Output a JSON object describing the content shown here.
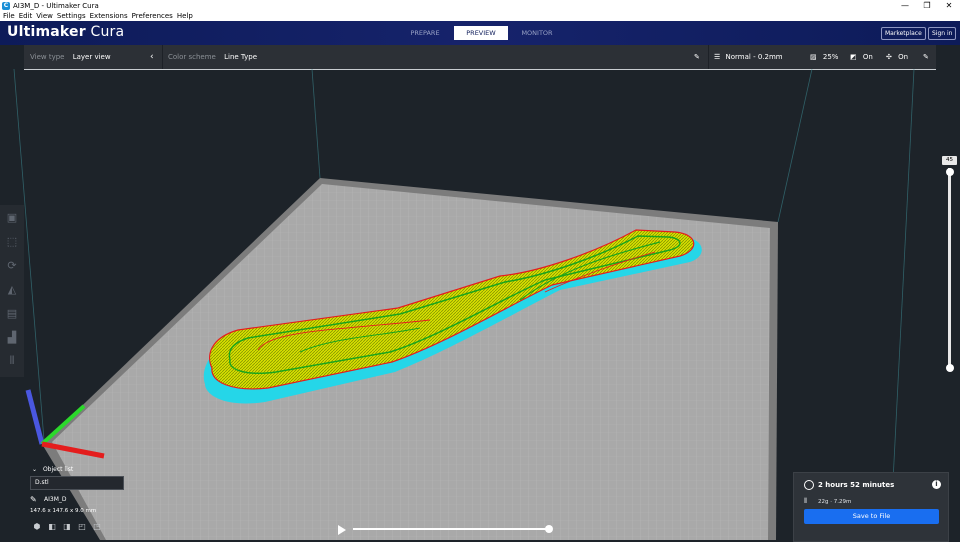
{
  "window": {
    "title": "AI3M_D - Ultimaker Cura",
    "controls": [
      "—",
      "❐",
      "✕"
    ]
  },
  "menu": [
    "File",
    "Edit",
    "View",
    "Settings",
    "Extensions",
    "Preferences",
    "Help"
  ],
  "header": {
    "logo_bold": "Ultimaker",
    "logo_light": "Cura",
    "stages": [
      "PREPARE",
      "PREVIEW",
      "MONITOR"
    ],
    "active_stage": "PREVIEW",
    "marketplace_label": "Marketplace",
    "signin_label": "Sign in"
  },
  "toolbar": {
    "view_type_label": "View type",
    "view_type_value": "Layer view",
    "color_scheme_label": "Color scheme",
    "color_scheme_value": "Line Type",
    "profile": "Normal - 0.2mm",
    "infill": "25%",
    "support": "On",
    "adhesion": "On"
  },
  "layer": {
    "current": "45",
    "fraction": 1.0
  },
  "object_list": {
    "title": "Object list",
    "file": "D.stl",
    "object_name": "AI3M_D",
    "dimensions": "147.6 x 147.6 x 9.0 mm"
  },
  "simulation": {
    "progress": 1.0
  },
  "print_info": {
    "time": "2 hours 52 minutes",
    "material": "22g · 7.29m",
    "save_label": "Save to File"
  },
  "colors": {
    "header_bg": "#0d1b59",
    "accent": "#196ef0",
    "background": "#1d2329",
    "infill": "#e8e800",
    "wall_inner": "#22c422",
    "wall_outer": "#e41d1d",
    "support": "#25d6e8"
  }
}
